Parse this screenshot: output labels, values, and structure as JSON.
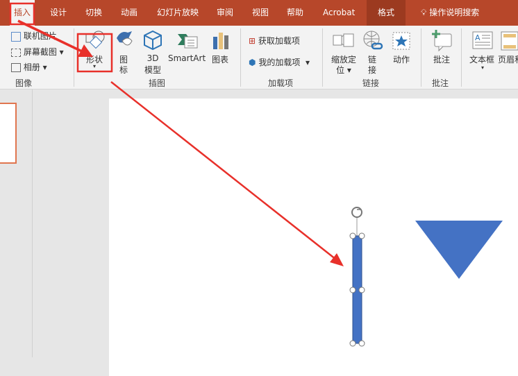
{
  "tabs": [
    "插入",
    "设计",
    "切换",
    "动画",
    "幻灯片放映",
    "审阅",
    "视图",
    "帮助",
    "Acrobat",
    "格式"
  ],
  "tell_me": "操作说明搜索",
  "ribbon": {
    "images_group": {
      "label": "图像",
      "items": [
        "联机图片",
        "屏幕截图",
        "相册"
      ]
    },
    "illustrations_group": {
      "label": "插图",
      "shape": "形状",
      "icons": [
        "图",
        "标"
      ],
      "model3d": [
        "3D",
        "模型"
      ],
      "smartart": "SmartArt",
      "chart": "图表"
    },
    "addins_group": {
      "label": "加载项",
      "get": "获取加载项",
      "mine": "我的加载项"
    },
    "links_group": {
      "label": "链接",
      "zoom": [
        "缩放定",
        "位"
      ],
      "link": [
        "链",
        "接"
      ],
      "action": "动作"
    },
    "comments_group": {
      "label": "批注",
      "comment": "批注"
    },
    "text_group": {
      "textbox": "文本框",
      "header": "页眉和"
    }
  },
  "colors": {
    "accent": "#b7472a",
    "shape": "#4472c4",
    "annotation": "#e8302a"
  }
}
